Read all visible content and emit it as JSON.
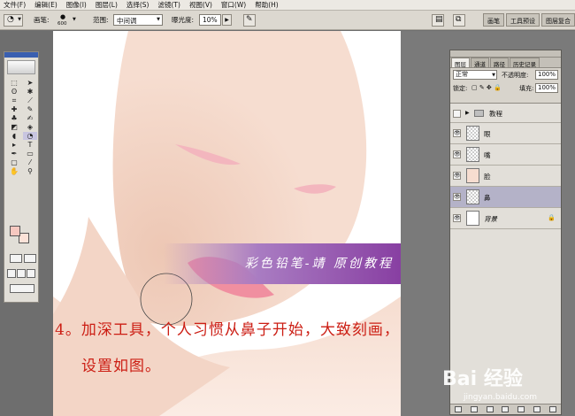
{
  "menubar": {
    "items": [
      "文件(F)",
      "编辑(E)",
      "图像(I)",
      "图层(L)",
      "选择(S)",
      "滤镜(T)",
      "视图(V)",
      "窗口(W)",
      "帮助(H)"
    ]
  },
  "options": {
    "brush_label": "画笔:",
    "brush_size": "600",
    "range_label": "范围:",
    "range_value": "中间调",
    "exposure_label": "曝光度:",
    "exposure_value": "10%",
    "wells": [
      "画笔",
      "工具预设",
      "图层复合"
    ]
  },
  "layers_panel": {
    "tabs": [
      "图层",
      "通道",
      "路径",
      "历史记录"
    ],
    "blend_mode": "正常",
    "opacity_label": "不透明度:",
    "opacity_value": "100%",
    "lock_label": "锁定:",
    "fill_label": "填充:",
    "fill_value": "100%",
    "group_name": "教程",
    "layers": [
      {
        "name": "眼",
        "thumb": "checker",
        "selected": false
      },
      {
        "name": "嘴",
        "thumb": "checker",
        "selected": false
      },
      {
        "name": "脸",
        "thumb": "skin",
        "selected": false
      },
      {
        "name": "鼻",
        "thumb": "checker",
        "selected": true
      }
    ],
    "background_layer": "背景"
  },
  "canvas": {
    "banner_text": "彩色铅笔-靖 原创教程",
    "caption_line1": "4。加深工具，个人习惯从鼻子开始，大致刻画，",
    "caption_line2": "设置如图。"
  },
  "watermark": {
    "main": "Bai 经验",
    "sub": "jingyan.baidu.com"
  },
  "colors": {
    "skin": "#f6ddd0",
    "eye_pink": "#f3b6be",
    "lip_pink": "#f08fa0",
    "banner_purple": "#883fa2",
    "caption_red": "#cc1e14"
  }
}
